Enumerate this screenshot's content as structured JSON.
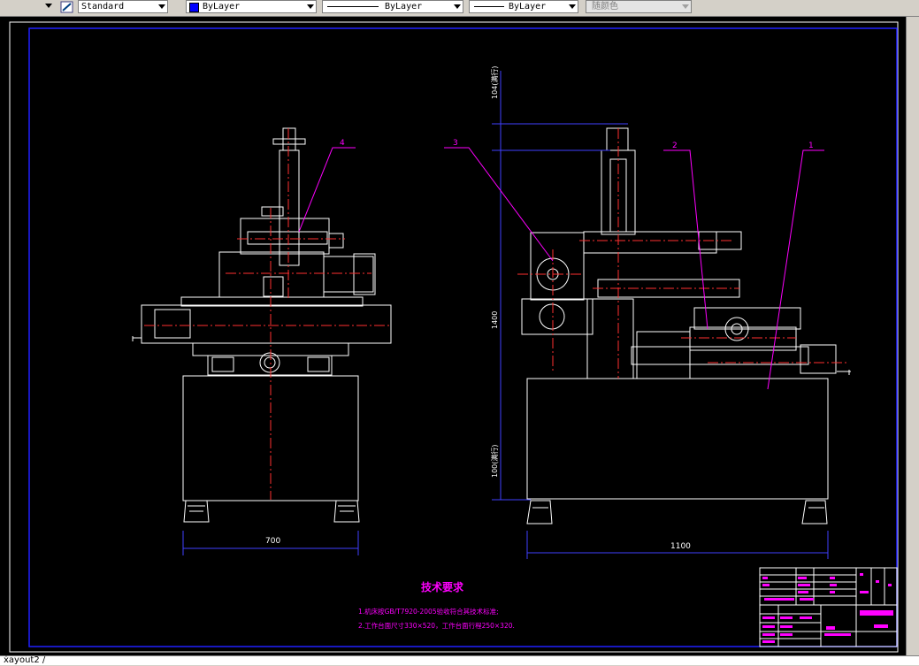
{
  "toolbar": {
    "text_style": "Standard",
    "color_value": "ByLayer",
    "linetype_value": "ByLayer",
    "lineweight_value": "ByLayer",
    "plotstyle_value": "随颜色"
  },
  "colors": {
    "canvas": "#000000",
    "border": "#0000ff",
    "geometry": "#ffffff",
    "centerline": "#ff0000",
    "leaders": "#ff00ff",
    "text": "#ff00ff",
    "dimension": "#4040ff"
  },
  "drawing": {
    "front_view": {
      "dim_width": "700"
    },
    "side_view": {
      "dim_width": "1100",
      "dim_top": "104(满行)",
      "dim_middle": "1400",
      "dim_bottom": "100(满行)"
    },
    "part_labels": [
      "1",
      "2",
      "3",
      "4"
    ],
    "tech_requirements": {
      "title": "技术要求",
      "line1": "1.机床按GB/T7920-2005验收符合其技术标准;",
      "line2": "2.工作台面尺寸330×520，工作台面行程250×320."
    }
  },
  "layout_tabs": {
    "active": "ẋayout2 /"
  }
}
